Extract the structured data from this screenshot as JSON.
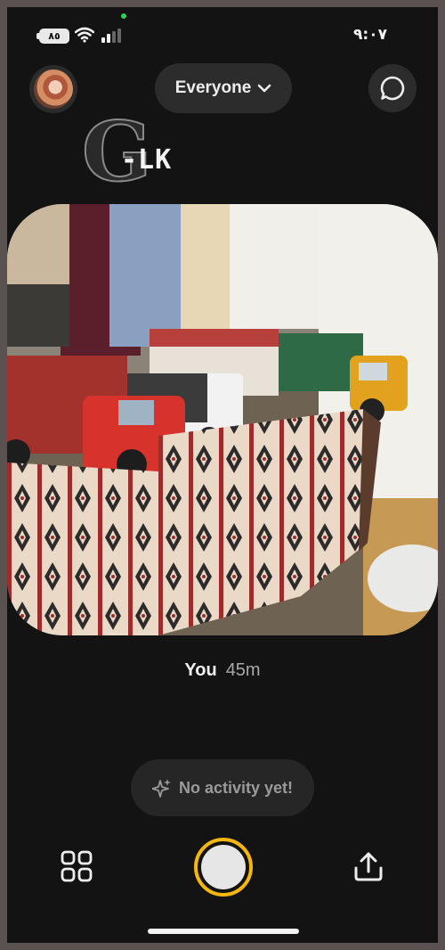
{
  "status_bar": {
    "battery": "٨٥",
    "time": "٩:٠٧"
  },
  "header": {
    "audience_label": "Everyone",
    "watermark_letter": "G",
    "watermark_text": "-LK"
  },
  "post": {
    "author": "You",
    "age": "45m"
  },
  "activity": {
    "label": "No activity yet!"
  },
  "colors": {
    "accent": "#f5b70e",
    "background": "#131313",
    "pill": "#2c2c2c"
  },
  "icons": {
    "chat": "chat-bubble-icon",
    "grid": "grid-icon",
    "share": "share-icon",
    "sparkle": "sparkle-icon",
    "chevron": "chevron-down-icon"
  }
}
